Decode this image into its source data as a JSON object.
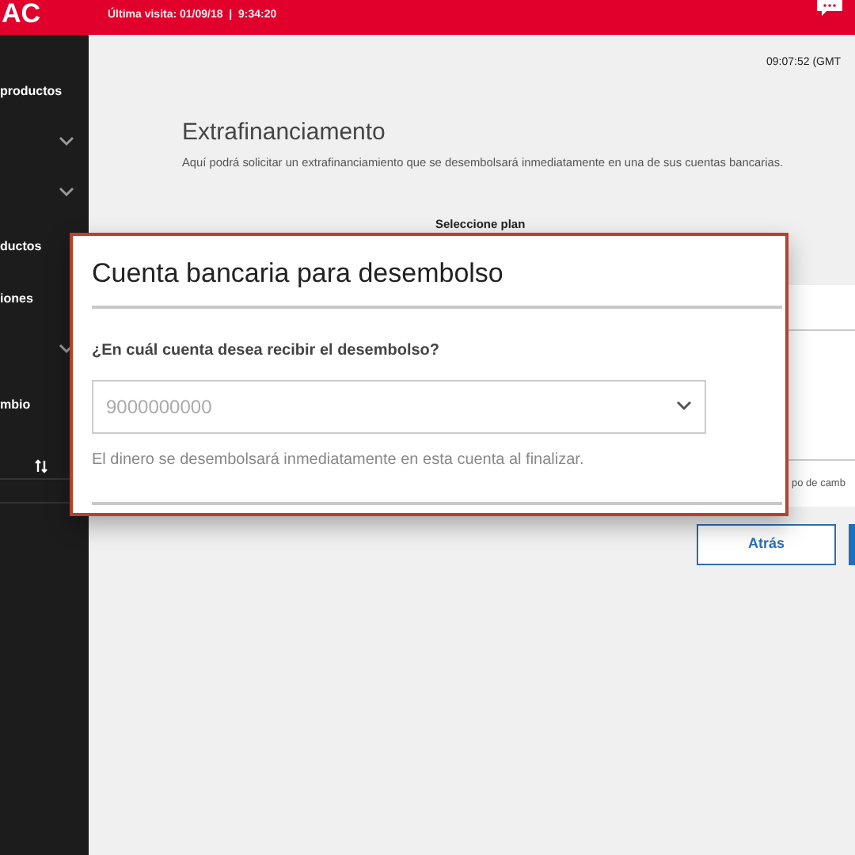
{
  "header": {
    "logo": "AC",
    "last_visit": "Última visita: 01/09/18  |  9:34:20"
  },
  "sidebar": {
    "items": [
      {
        "kind": "text",
        "label": "productos"
      },
      {
        "kind": "chevron"
      },
      {
        "kind": "chevron"
      },
      {
        "kind": "text",
        "label": "ductos"
      },
      {
        "kind": "text",
        "label": "iones"
      },
      {
        "kind": "chevron"
      },
      {
        "kind": "text",
        "label": "mbio"
      },
      {
        "kind": "swap"
      }
    ]
  },
  "main": {
    "time": "09:07:52 (GMT",
    "title": "Extrafinanciamento",
    "description": "Aquí podrá solicitar un extrafinanciamiento que se desembolsará inmediatamente en una de sus cuentas bancarias.",
    "plan_label": "Seleccione plan",
    "card_fragment": "po de camb",
    "back_button": "Atrás"
  },
  "modal": {
    "title": "Cuenta bancaria para desembolso",
    "question": "¿En cuál cuenta desea recibir el desembolso?",
    "account_select": {
      "placeholder": "9000000000"
    },
    "hint": "El dinero se desembolsará inmediatamente en esta cuenta al finalizar."
  }
}
